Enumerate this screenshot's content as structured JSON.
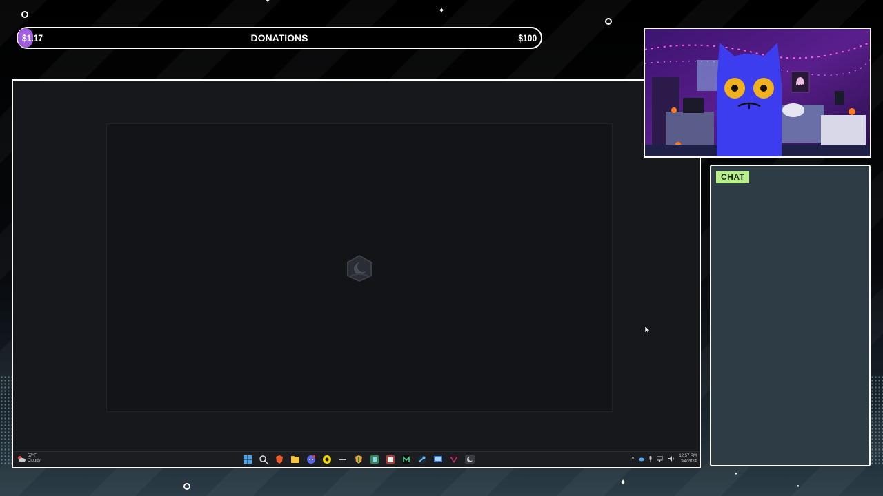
{
  "donation": {
    "current": "$1.17",
    "title": "DONATIONS",
    "goal": "$100",
    "progress_fraction": 0.0117,
    "fill_color": "#a15ce0"
  },
  "chat": {
    "label": "CHAT",
    "label_color": "#b7f08a",
    "background": "#2e3c46"
  },
  "taskbar": {
    "weather_temp": "57°F",
    "weather_desc": "Cloudy",
    "clock_time": "12:57 PM",
    "clock_date": "3/4/2024",
    "pinned_icons": [
      "windows-start-icon",
      "search-icon",
      "brave-browser-icon",
      "file-explorer-icon",
      "discord-icon",
      "ai-assistant-icon",
      "live-app-icon",
      "shield-app-icon",
      "photos-app-icon",
      "game-launcher-icon",
      "m-app-icon",
      "steam-icon",
      "monitor-app-icon",
      "vpn-app-icon",
      "media-app-icon"
    ],
    "tray_icons": [
      "chevron-up-icon",
      "onedrive-icon",
      "microphone-icon",
      "network-icon",
      "volume-icon"
    ]
  },
  "webcam": {
    "character": "blue cat vtuber avatar",
    "background": "purple bedroom"
  },
  "app_window": {
    "logo_icon": "moon-house-logo-icon"
  }
}
